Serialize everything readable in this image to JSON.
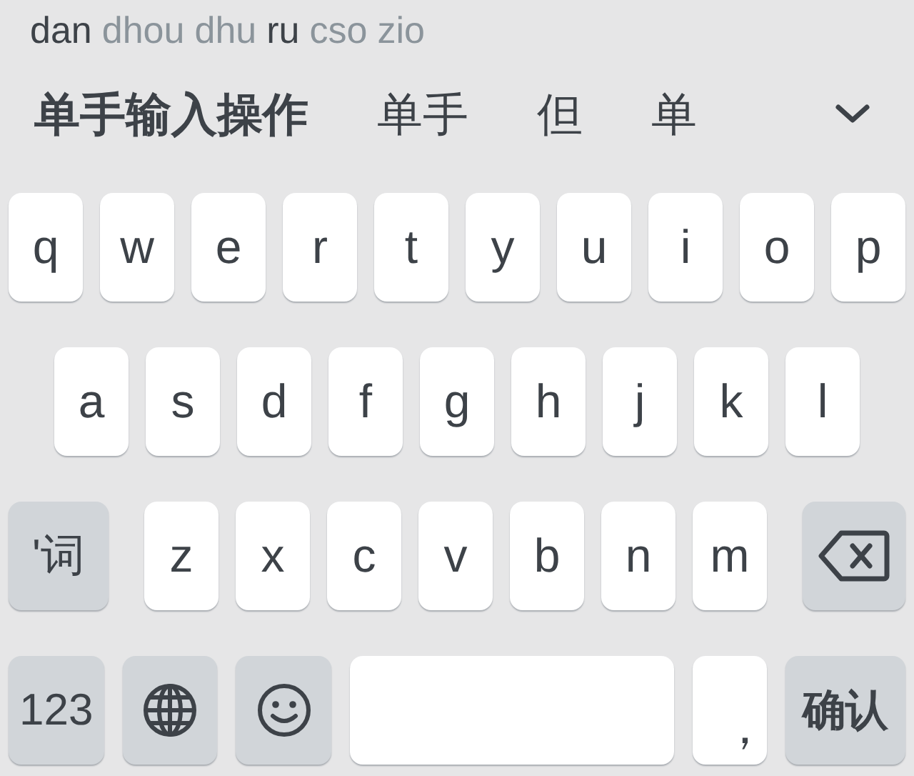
{
  "pinyin": [
    {
      "text": "dan",
      "matched": true
    },
    {
      "text": "dhou",
      "matched": false
    },
    {
      "text": "dhu",
      "matched": false
    },
    {
      "text": "ru",
      "matched": true
    },
    {
      "text": "cso",
      "matched": false
    },
    {
      "text": "zio",
      "matched": false
    }
  ],
  "candidates": [
    {
      "text": "单手输入操作",
      "selected": true
    },
    {
      "text": "单手",
      "selected": false
    },
    {
      "text": "但",
      "selected": false
    },
    {
      "text": "单",
      "selected": false
    }
  ],
  "rows": [
    [
      {
        "kind": "letter",
        "label": "q"
      },
      {
        "kind": "letter",
        "label": "w"
      },
      {
        "kind": "letter",
        "label": "e"
      },
      {
        "kind": "letter",
        "label": "r"
      },
      {
        "kind": "letter",
        "label": "t"
      },
      {
        "kind": "letter",
        "label": "y"
      },
      {
        "kind": "letter",
        "label": "u"
      },
      {
        "kind": "letter",
        "label": "i"
      },
      {
        "kind": "letter",
        "label": "o"
      },
      {
        "kind": "letter",
        "label": "p"
      }
    ],
    [
      {
        "kind": "letter",
        "label": "a"
      },
      {
        "kind": "letter",
        "label": "s"
      },
      {
        "kind": "letter",
        "label": "d"
      },
      {
        "kind": "letter",
        "label": "f"
      },
      {
        "kind": "letter",
        "label": "g"
      },
      {
        "kind": "letter",
        "label": "h"
      },
      {
        "kind": "letter",
        "label": "j"
      },
      {
        "kind": "letter",
        "label": "k"
      },
      {
        "kind": "letter",
        "label": "l"
      }
    ],
    [
      {
        "kind": "function",
        "label": "'词"
      },
      {
        "kind": "letter",
        "label": "z"
      },
      {
        "kind": "letter",
        "label": "x"
      },
      {
        "kind": "letter",
        "label": "c"
      },
      {
        "kind": "letter",
        "label": "v"
      },
      {
        "kind": "letter",
        "label": "b"
      },
      {
        "kind": "letter",
        "label": "n"
      },
      {
        "kind": "letter",
        "label": "m"
      },
      {
        "kind": "backspace"
      }
    ],
    [
      {
        "kind": "function",
        "label": "123"
      },
      {
        "kind": "globe"
      },
      {
        "kind": "emoji"
      },
      {
        "kind": "space"
      },
      {
        "kind": "comma",
        "label": "，"
      },
      {
        "kind": "return",
        "label": "确认"
      }
    ]
  ]
}
